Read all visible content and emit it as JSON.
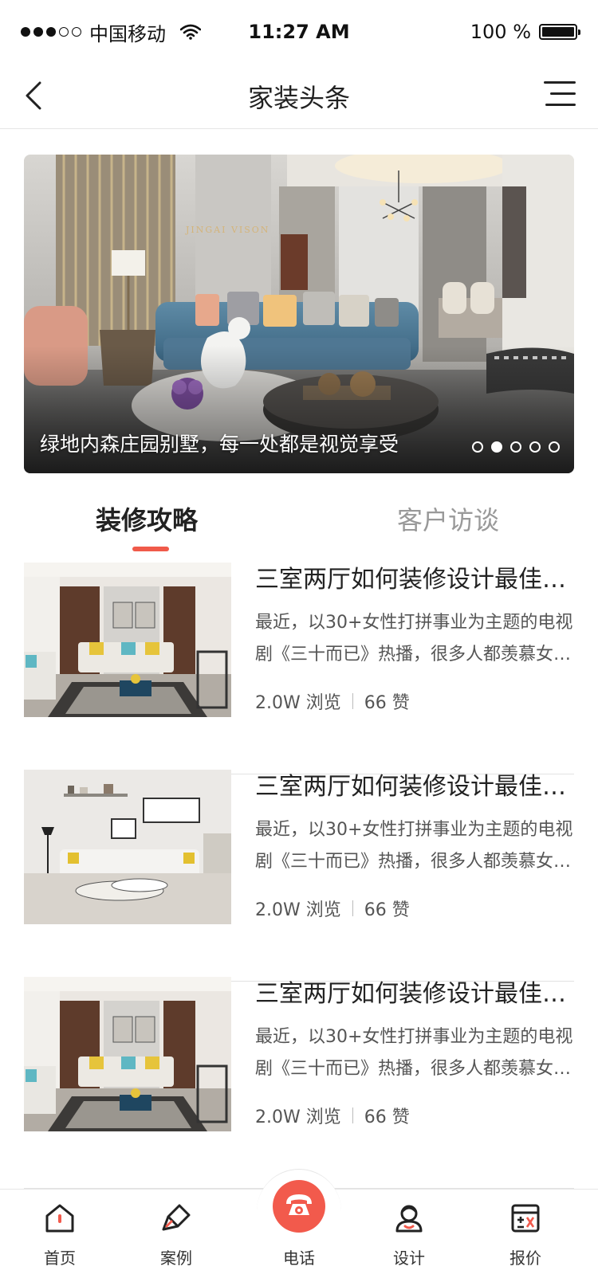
{
  "status_bar": {
    "carrier": "中国移动",
    "time": "11:27 AM",
    "battery": "100 %",
    "battery_level": 1.0,
    "signal_bars_filled": 3,
    "signal_bars_total": 5
  },
  "nav": {
    "title": "家装头条",
    "back_icon": "chevron-left-icon",
    "menu_icon": "list-menu-icon"
  },
  "banner": {
    "caption": "绿地内森庄园别墅，每一处都是视觉享受",
    "watermark": "JINGAI VISON",
    "slides_total": 5,
    "active_slide": 2
  },
  "tabs": [
    {
      "label": "装修攻略",
      "active": true
    },
    {
      "label": "客户访谈",
      "active": false
    }
  ],
  "articles": [
    {
      "title": "三室两厅如何装修设计最佳？还有哪些注意事项",
      "desc_line1": "最近，以30+女性打拼事业为主题的电视",
      "desc_line2": "剧《三十而已》热播，很多人都羡慕女主角",
      "views": "2.0W 浏览",
      "likes": "66 赞"
    },
    {
      "title": "三室两厅如何装修设计最佳？还有哪些注意事项",
      "desc_line1": "最近，以30+女性打拼事业为主题的电视",
      "desc_line2": "剧《三十而已》热播，很多人都羡慕女主角",
      "views": "2.0W 浏览",
      "likes": "66 赞"
    },
    {
      "title": "三室两厅如何装修设计最佳？还有哪些注意事项",
      "desc_line1": "最近，以30+女性打拼事业为主题的电视",
      "desc_line2": "剧《三十而已》热播，很多人都羡慕女主角",
      "views": "2.0W 浏览",
      "likes": "66 赞"
    }
  ],
  "tabbar": {
    "items": [
      {
        "label": "首页",
        "icon": "home-icon"
      },
      {
        "label": "案例",
        "icon": "brush-icon"
      },
      {
        "label": "电话",
        "icon": "phone-icon"
      },
      {
        "label": "设计",
        "icon": "designer-icon"
      },
      {
        "label": "报价",
        "icon": "calculator-icon"
      }
    ]
  },
  "colors": {
    "accent": "#f25a4c",
    "text_primary": "#222222",
    "text_secondary": "#555555",
    "tab_inactive": "#999999"
  }
}
